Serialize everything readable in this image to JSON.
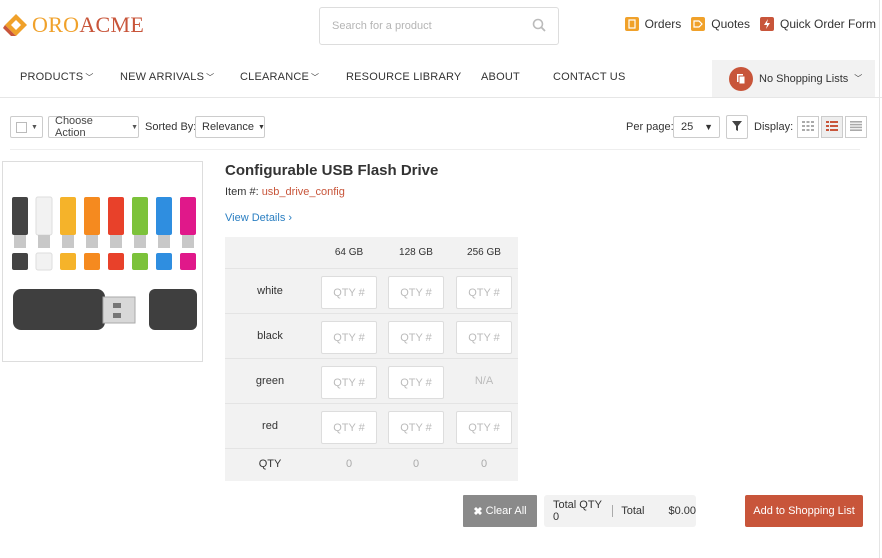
{
  "brand": {
    "part1": "ORO",
    "part2": "ACME",
    "color_primary": "#c8553a",
    "color_secondary": "#f0a12a"
  },
  "search": {
    "placeholder": "Search for a product",
    "icon": "search-icon"
  },
  "top_links": [
    {
      "label": "Orders",
      "icon": "orders-icon",
      "color": "#f0a12a"
    },
    {
      "label": "Quotes",
      "icon": "quotes-icon",
      "color": "#f0a12a"
    },
    {
      "label": "Quick Order Form",
      "icon": "quick-order-icon",
      "color": "#c8553a"
    }
  ],
  "nav": {
    "items": [
      {
        "label": "PRODUCTS",
        "has_dropdown": true
      },
      {
        "label": "NEW ARRIVALS",
        "has_dropdown": true
      },
      {
        "label": "CLEARANCE",
        "has_dropdown": true
      },
      {
        "label": "RESOURCE LIBRARY",
        "has_dropdown": false
      },
      {
        "label": "ABOUT",
        "has_dropdown": false
      },
      {
        "label": "CONTACT US",
        "has_dropdown": false
      }
    ],
    "shopping_lists": "No Shopping Lists"
  },
  "toolbar": {
    "choose_action": "Choose Action",
    "sorted_by_label": "Sorted By:",
    "sort_value": "Relevance",
    "per_page_label": "Per page:",
    "per_page_value": "25",
    "display_label": "Display:"
  },
  "product": {
    "title": "Configurable USB Flash Drive",
    "item_label": "Item #:",
    "sku": "usb_drive_config",
    "view_details": "View Details"
  },
  "matrix": {
    "columns": [
      "64 GB",
      "128 GB",
      "256 GB"
    ],
    "rows": [
      {
        "label": "white",
        "cells": [
          "QTY #",
          "QTY #",
          "QTY #"
        ]
      },
      {
        "label": "black",
        "cells": [
          "QTY #",
          "QTY #",
          "QTY #"
        ]
      },
      {
        "label": "green",
        "cells": [
          "QTY #",
          "QTY #",
          "N/A"
        ]
      },
      {
        "label": "red",
        "cells": [
          "QTY #",
          "QTY #",
          "QTY #"
        ]
      }
    ],
    "qty_label": "QTY",
    "totals": [
      "0",
      "0",
      "0"
    ]
  },
  "footer": {
    "clear_all": "Clear All",
    "total_qty": "Total QTY 0",
    "total_label": "Total",
    "total_value": "$0.00",
    "add_button": "Add to Shopping List"
  }
}
